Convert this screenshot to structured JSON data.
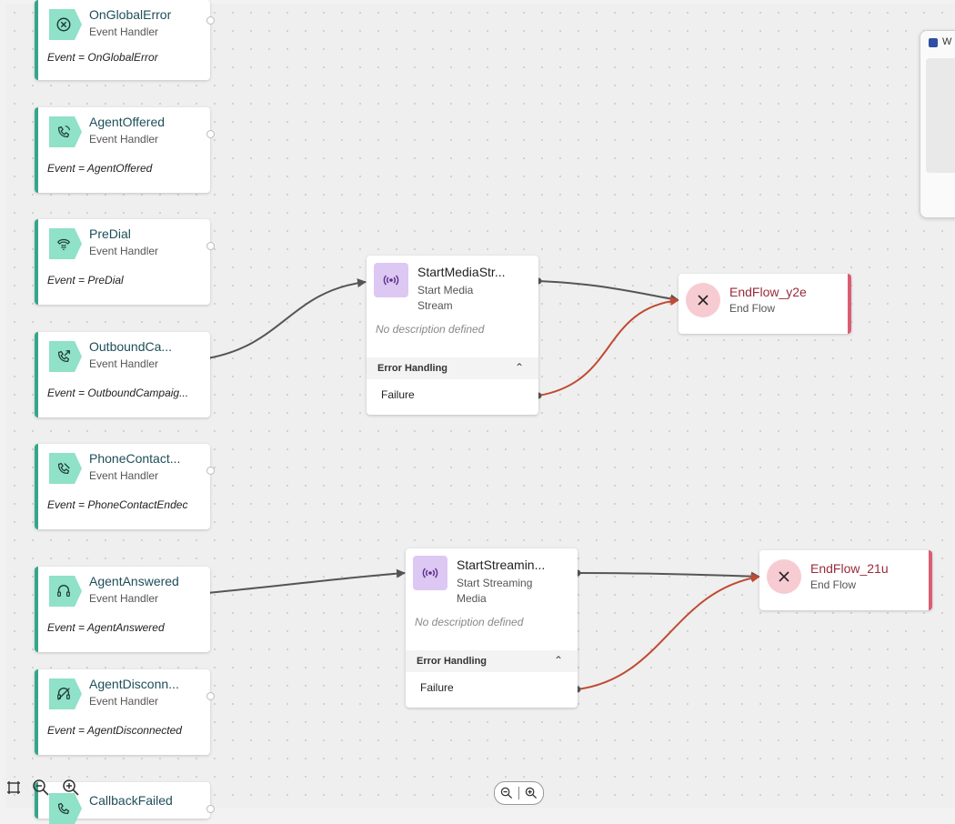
{
  "handlers": [
    {
      "title": "OnGlobalError",
      "subtitle": "Event Handler",
      "event": "Event = OnGlobalError",
      "icon": "error-circle-icon"
    },
    {
      "title": "AgentOffered",
      "subtitle": "Event Handler",
      "event": "Event = AgentOffered",
      "icon": "phone-ringing-icon"
    },
    {
      "title": "PreDial",
      "subtitle": "Event Handler",
      "event": "Event = PreDial",
      "icon": "dialpad-phone-icon"
    },
    {
      "title": "OutboundCa...",
      "subtitle": "Event Handler",
      "event": "Event = OutboundCampaig...",
      "icon": "phone-outgoing-icon"
    },
    {
      "title": "PhoneContact...",
      "subtitle": "Event Handler",
      "event": "Event = PhoneContactEndec",
      "icon": "phone-ended-icon"
    },
    {
      "title": "AgentAnswered",
      "subtitle": "Event Handler",
      "event": "Event = AgentAnswered",
      "icon": "headset-icon"
    },
    {
      "title": "AgentDisconn...",
      "subtitle": "Event Handler",
      "event": "Event = AgentDisconnected",
      "icon": "headset-off-icon"
    },
    {
      "title": "CallbackFailed",
      "subtitle": "",
      "event": "",
      "icon": "callback-failed-icon"
    }
  ],
  "actions": [
    {
      "title": "StartMediaStr...",
      "subtitle_line1": "Start Media",
      "subtitle_line2": "Stream",
      "description": "No description defined",
      "error_label": "Error Handling",
      "failure_label": "Failure"
    },
    {
      "title": "StartStreamin...",
      "subtitle_line1": "Start Streaming",
      "subtitle_line2": "Media",
      "description": "No description defined",
      "error_label": "Error Handling",
      "failure_label": "Failure"
    }
  ],
  "endflows": [
    {
      "title": "EndFlow_y2e",
      "subtitle": "End Flow"
    },
    {
      "title": "EndFlow_21u",
      "subtitle": "End Flow"
    }
  ],
  "side_panel": {
    "title_fragment": "W"
  },
  "colors": {
    "handler_accent": "#36a68b",
    "handler_icon_bg": "#8fe1c8",
    "action_icon_bg": "#ddc7f3",
    "endflow_accent": "#d95e72",
    "success_wire": "#555555",
    "error_wire": "#c04a32"
  }
}
